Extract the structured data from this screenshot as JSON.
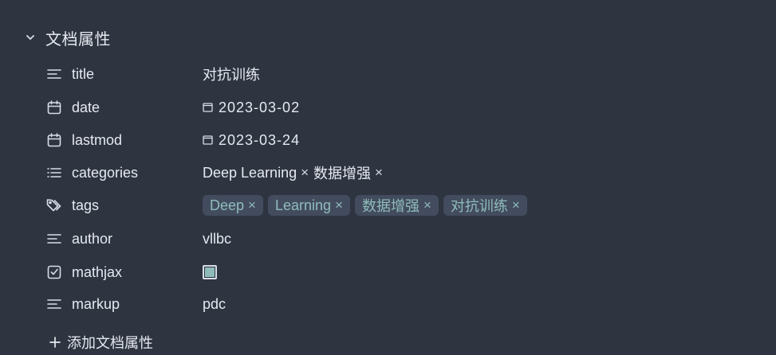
{
  "section": {
    "title": "文档属性",
    "expand_icon": "chevron-down-icon"
  },
  "properties": {
    "title": {
      "key": "title",
      "icon": "text-lines-icon",
      "value": "对抗训练"
    },
    "date": {
      "key": "date",
      "icon": "calendar-icon",
      "value": "2023-03-02"
    },
    "lastmod": {
      "key": "lastmod",
      "icon": "calendar-icon",
      "value": "2023-03-24"
    },
    "categories": {
      "key": "categories",
      "icon": "list-icon",
      "items": [
        "Deep Learning",
        "数据增强"
      ]
    },
    "tags": {
      "key": "tags",
      "icon": "tags-icon",
      "items": [
        "Deep",
        "Learning",
        "数据增强",
        "对抗训练"
      ]
    },
    "author": {
      "key": "author",
      "icon": "text-lines-icon",
      "value": "vllbc"
    },
    "mathjax": {
      "key": "mathjax",
      "icon": "checkbox-icon",
      "checked": true
    },
    "markup": {
      "key": "markup",
      "icon": "text-lines-icon",
      "value": "pdc"
    }
  },
  "remove_glyph": "×",
  "add_property_label": "添加文档属性",
  "colors": {
    "background": "#2e3440",
    "text": "#e5e9f0",
    "tag_bg": "#434c5e",
    "tag_text": "#8fbcbb"
  }
}
